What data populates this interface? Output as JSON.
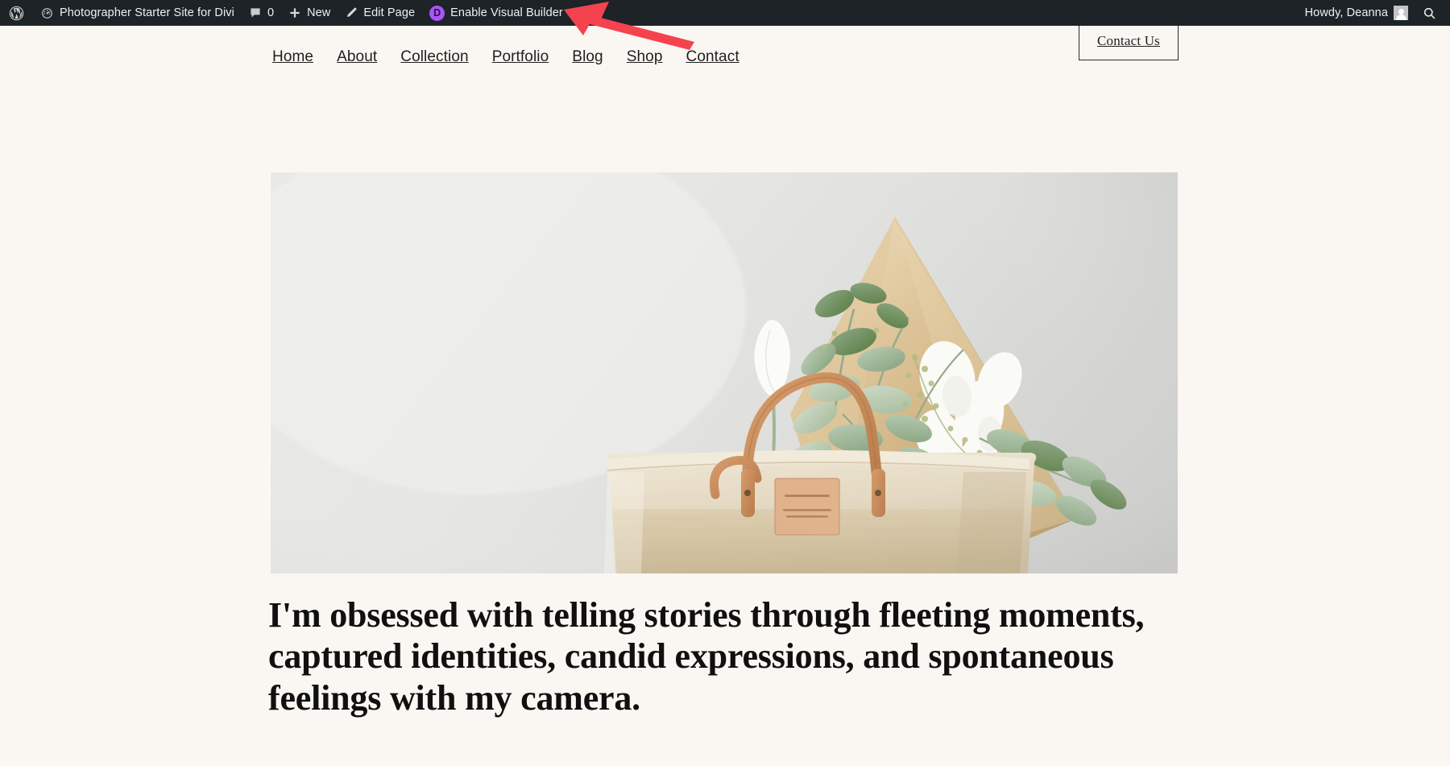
{
  "admin_bar": {
    "wp_logo_icon": "wordpress-logo-icon",
    "site_icon": "dashboard-speedometer-icon",
    "site_name": "Photographer Starter Site for Divi",
    "comments_icon": "comment-bubble-icon",
    "comments_count": "0",
    "new_icon": "plus-icon",
    "new_label": "New",
    "edit_icon": "pencil-icon",
    "edit_label": "Edit Page",
    "divi_badge_letter": "D",
    "visual_builder_label": "Enable Visual Builder",
    "howdy_label": "Howdy, Deanna",
    "avatar_icon": "user-avatar-icon",
    "search_icon": "search-icon",
    "background_color": "#1d2327",
    "text_color": "#f0f0f1",
    "divi_accent_color": "#a855f7"
  },
  "site_header": {
    "nav_items": [
      {
        "label": "Home"
      },
      {
        "label": "About"
      },
      {
        "label": "Collection"
      },
      {
        "label": "Portfolio"
      },
      {
        "label": "Blog"
      },
      {
        "label": "Shop"
      },
      {
        "label": "Contact"
      }
    ],
    "cta_label": "Contact Us"
  },
  "hero": {
    "image_alt": "Jute tote bag holding a bouquet of white tulips and eucalyptus wrapped in kraft paper against a pale gray wall",
    "heading": "I'm obsessed with telling stories through fleeting moments, captured identities, candid expressions, and spontaneous feelings with my camera."
  },
  "annotation": {
    "type": "arrow",
    "direction": "points-left-to-enable-visual-builder",
    "color": "#f4434f"
  },
  "theme": {
    "page_background": "#faf7f2",
    "text_color": "#101010"
  }
}
